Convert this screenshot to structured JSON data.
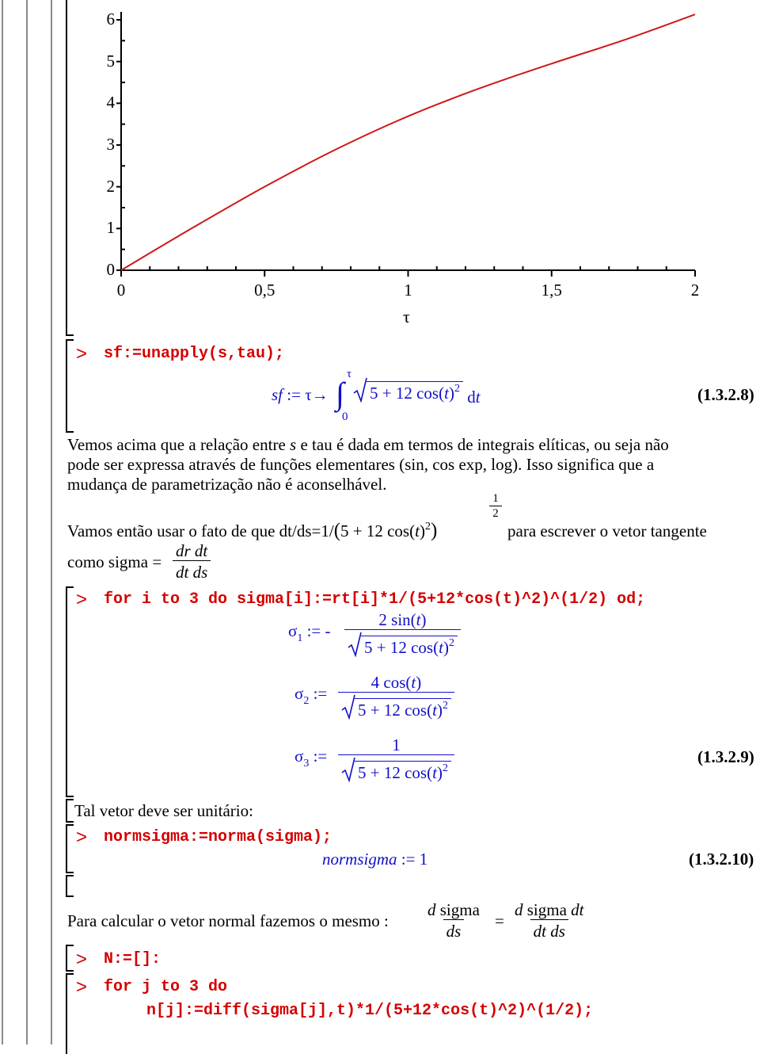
{
  "plot": {
    "chart_data": {
      "type": "line",
      "title": "",
      "xlabel": "τ",
      "ylabel": "",
      "xlim": [
        0,
        2
      ],
      "ylim": [
        0,
        6
      ],
      "x_ticks": [
        "0",
        "0,5",
        "1",
        "1,5",
        "2"
      ],
      "y_ticks": [
        "0",
        "1",
        "2",
        "3",
        "4",
        "5",
        "6"
      ],
      "grid": false,
      "series": [
        {
          "color": "#d01818",
          "x": [
            0,
            0.25,
            0.5,
            0.75,
            1,
            1.25,
            1.5,
            1.75,
            2
          ],
          "y": [
            0,
            1.02,
            2.0,
            2.9,
            3.69,
            4.36,
            4.95,
            5.51,
            6.13
          ]
        }
      ]
    }
  },
  "colors": {
    "code": "#d40000",
    "math": "#1010c8",
    "curve": "#d01818"
  },
  "icons": {
    "prompt": "greater-than-prompt-icon"
  },
  "prompt": ">",
  "sqrt_expr": {
    "pre": "5 + 12 cos(",
    "var": "t",
    "post": ")",
    "exp": "2"
  },
  "cmd1": {
    "code": "sf:=unapply(s,tau);",
    "lhs": "sf",
    "assign": " := τ→",
    "int_sign": "∫",
    "upper": "τ",
    "lower": "0",
    "d": " d",
    "dvar": "t",
    "label": "(1.3.2.8)"
  },
  "para1": {
    "line1a": "Vemos acima que a relação entre ",
    "line1s": "s",
    "line1b": " e tau é dada em termos de integrais elíticas, ou seja não",
    "line2": "pode ser expressa através de funções elementares (sin, cos exp, log). Isso significa que a",
    "line3": "mudança de parametrização não é aconselhável."
  },
  "para2": {
    "pre": "Vamos então usar o fato de que dt/ds=1/",
    "open": "(",
    "expr_pre": "5 + 12 cos(",
    "expr_var": "t",
    "expr_post": ")",
    "expr_exp": "2",
    "close": ")",
    "exp_num": "1",
    "exp_den": "2",
    "post": "para escrever o vetor tangente",
    "line2": "como sigma = ",
    "frac_num": "dr dt",
    "frac_den": "dt ds"
  },
  "cmd2": {
    "code": "for i to 3 do sigma[i]:=rt[i]*1/(5+12*cos(t)^2)^(1/2) od;",
    "sigma": "σ",
    "assign": " :=",
    "minus": " - ",
    "rows": [
      {
        "sub": "1",
        "num_pre": "2 sin(",
        "num_var": "t",
        "num_post": ")"
      },
      {
        "sub": "2",
        "num_pre": "4 cos(",
        "num_var": "t",
        "num_post": ")"
      },
      {
        "sub": "3",
        "num_pre": "1",
        "num_var": "",
        "num_post": ""
      }
    ],
    "label": "(1.3.2.9)"
  },
  "text_unit": "Tal vetor deve ser unitário:",
  "cmd3": {
    "code": "normsigma:=norma(sigma);",
    "result_lhs": "normsigma",
    "result_rhs": " := 1",
    "label": "(1.3.2.10)"
  },
  "para3": {
    "text": "Para calcular o vetor normal fazemos o mesmo : ",
    "f1_num_d": "d",
    "f1_num": " sigma",
    "f1_den": "ds",
    "eq": "=",
    "f2_num_d": "d",
    "f2_num": " sigma ",
    "f2_num_dt": "dt",
    "f2_den": "dt ds"
  },
  "cmd4": {
    "code": "N:=[]:"
  },
  "cmd5": {
    "line1": "for j to 3 do",
    "line2": "n[j]:=diff(sigma[j],t)*1/(5+12*cos(t)^2)^(1/2);"
  }
}
